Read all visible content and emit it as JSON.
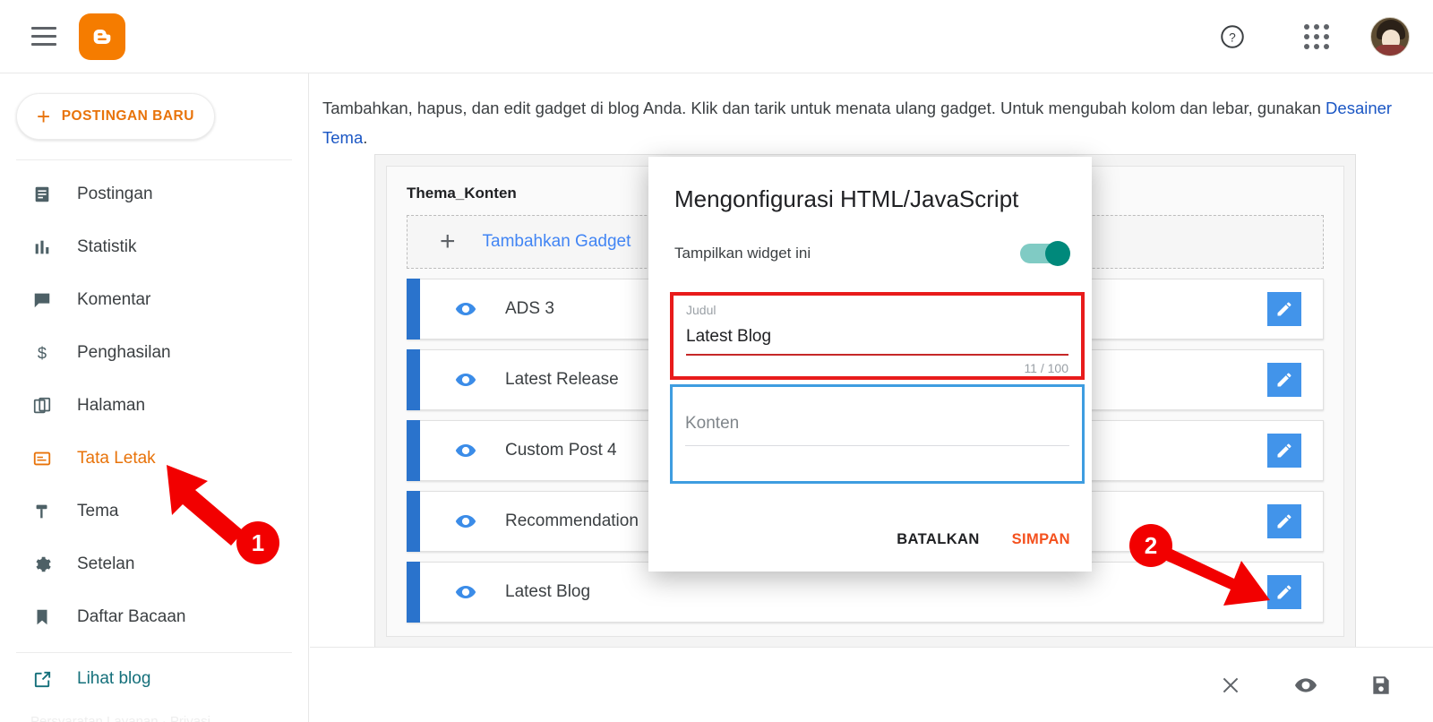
{
  "topbar": {
    "menu_icon": "hamburger-icon",
    "logo": "blogger-logo",
    "help_icon": "help-circle-icon",
    "apps_icon": "apps-grid-icon",
    "avatar": "user-avatar"
  },
  "sidebar": {
    "new_post_label": "POSTINGAN BARU",
    "new_post_plus": "+",
    "items": [
      {
        "label": "Postingan",
        "icon": "posts-icon",
        "active": false
      },
      {
        "label": "Statistik",
        "icon": "stats-icon",
        "active": false
      },
      {
        "label": "Komentar",
        "icon": "comment-icon",
        "active": false
      },
      {
        "label": "Penghasilan",
        "icon": "dollar-icon",
        "active": false
      },
      {
        "label": "Halaman",
        "icon": "pages-icon",
        "active": false
      },
      {
        "label": "Tata Letak",
        "icon": "layout-icon",
        "active": true
      },
      {
        "label": "Tema",
        "icon": "theme-icon",
        "active": false
      },
      {
        "label": "Setelan",
        "icon": "gear-icon",
        "active": false
      },
      {
        "label": "Daftar Bacaan",
        "icon": "bookmark-icon",
        "active": false
      }
    ],
    "view_blog_label": "Lihat blog",
    "view_blog_icon": "external-link-icon",
    "legal": "Persyaratan Layanan · Privasi"
  },
  "main": {
    "intro_text": "Tambahkan, hapus, dan edit gadget di blog Anda. Klik dan tarik untuk menata ulang gadget. Untuk mengubah kolom dan lebar, gunakan ",
    "intro_link": "Desainer Tema",
    "intro_period": ".",
    "section_title": "Thema_Konten",
    "add_gadget_label": "Tambahkan Gadget",
    "add_gadget_plus": "+",
    "gadgets": [
      {
        "name": "ADS 3",
        "visibility_icon": "eye-icon",
        "edit_icon": "pencil-icon"
      },
      {
        "name": "Latest Release",
        "visibility_icon": "eye-icon",
        "edit_icon": "pencil-icon"
      },
      {
        "name": "Custom Post 4",
        "visibility_icon": "eye-icon",
        "edit_icon": "pencil-icon"
      },
      {
        "name": "Recommendation",
        "visibility_icon": "eye-icon",
        "edit_icon": "pencil-icon"
      },
      {
        "name": "Latest Blog",
        "visibility_icon": "eye-icon",
        "edit_icon": "pencil-icon"
      }
    ]
  },
  "bottombar": {
    "icons": [
      {
        "name": "close-icon",
        "glyph": "×"
      },
      {
        "name": "preview-eye-icon",
        "glyph": ""
      },
      {
        "name": "save-disk-icon",
        "glyph": ""
      }
    ]
  },
  "dialog": {
    "title": "Mengonfigurasi HTML/JavaScript",
    "toggle_label": "Tampilkan widget ini",
    "toggle_state": "on",
    "title_field": {
      "label": "Judul",
      "value": "Latest Blog",
      "counter": "11 / 100"
    },
    "content_field": {
      "placeholder": "Konten",
      "value": ""
    },
    "cancel_label": "BATALKAN",
    "save_label": "SIMPAN"
  },
  "annotations": {
    "marker_1": "1",
    "marker_2": "2"
  },
  "colors": {
    "brand_orange": "#f57c00",
    "active_orange": "#e8730a",
    "link_blue": "#4285f4",
    "handle_blue": "#2a73cc",
    "edit_blue": "#4294ea",
    "teal": "#00897b",
    "annotation_red": "#f20000",
    "highlight_red": "#e81b1b",
    "highlight_blue": "#3e9de0",
    "save_orange": "#f4511e"
  }
}
